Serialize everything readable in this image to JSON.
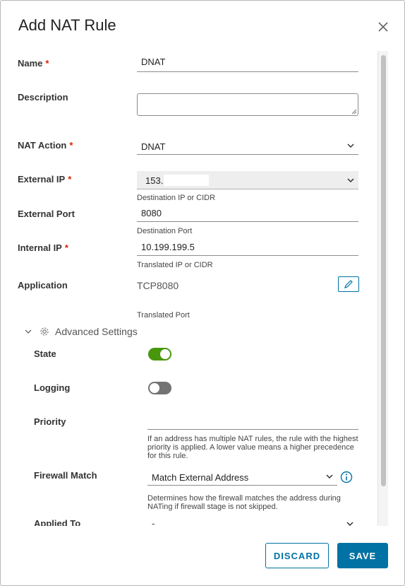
{
  "dialog": {
    "title": "Add NAT Rule"
  },
  "form": {
    "required_mark": "*",
    "name": {
      "label": "Name",
      "value": "DNAT"
    },
    "description": {
      "label": "Description",
      "value": ""
    },
    "nat_action": {
      "label": "NAT Action",
      "value": "DNAT"
    },
    "external_ip": {
      "label": "External IP",
      "value": "153. ",
      "help": "Destination IP or CIDR"
    },
    "external_port": {
      "label": "External Port",
      "value": "8080",
      "help": "Destination Port"
    },
    "internal_ip": {
      "label": "Internal IP",
      "value": "10.199.199.5",
      "help": "Translated IP or CIDR"
    },
    "application": {
      "label": "Application",
      "value": "TCP8080",
      "help": "Translated Port"
    }
  },
  "advanced": {
    "title": "Advanced Settings",
    "state": {
      "label": "State",
      "on": true
    },
    "logging": {
      "label": "Logging",
      "on": false
    },
    "priority": {
      "label": "Priority",
      "value": "",
      "help": "If an address has multiple NAT rules, the rule with the highest priority is applied. A lower value means a higher precedence for this rule."
    },
    "firewall_match": {
      "label": "Firewall Match",
      "value": "Match External Address",
      "help": "Determines how the firewall matches the address during NATing if firewall stage is not skipped."
    },
    "applied_to": {
      "label": "Applied To",
      "value": "-"
    }
  },
  "footer": {
    "discard": "DISCARD",
    "save": "SAVE"
  },
  "colors": {
    "accent": "#0072a3",
    "toggle_on": "#48960c",
    "toggle_off": "#737373",
    "required": "#e12200"
  }
}
